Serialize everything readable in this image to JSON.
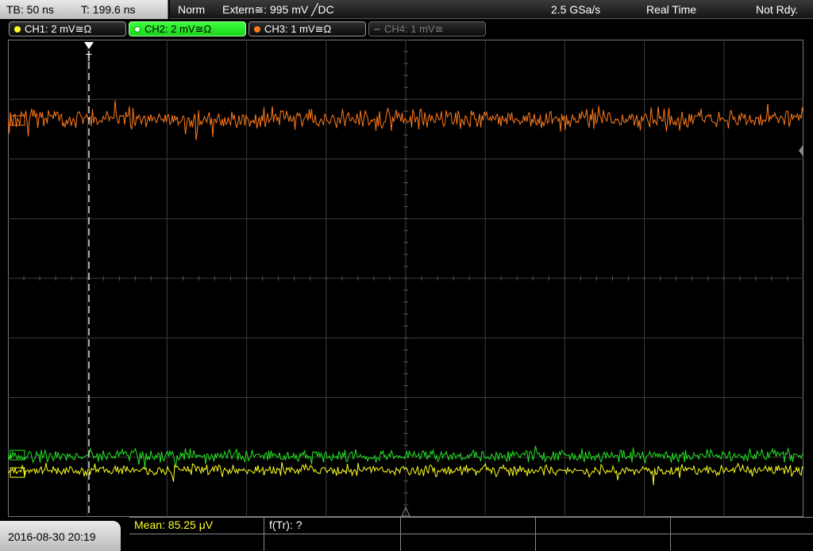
{
  "status_bar": {
    "timebase": "TB: 50 ns",
    "trigger_time": "T: 199.6 ns",
    "trigger_mode": "Norm",
    "trigger_source": "Extern≅: 995 mV ╱DC",
    "sample_rate": "2.5 GSa/s",
    "acq_mode": "Real Time",
    "acq_state": "Not Rdy."
  },
  "channels": [
    {
      "label": "CH1: 2 mV≅Ω",
      "color": "#ffff20",
      "state": "on"
    },
    {
      "label": "CH2: 2 mV≅Ω",
      "color": "#22e622",
      "state": "selected"
    },
    {
      "label": "CH3: 1 mV≅Ω",
      "color": "#ff7a1a",
      "state": "on"
    },
    {
      "label": "CH4: 1 mV≅",
      "color": "#7a7a7a",
      "state": "off"
    }
  ],
  "icons": {
    "trigger_marker": "trigger-position-arrow-icon",
    "trigger_level": "trigger-level-icon",
    "bottom_marker": "center-position-triangle-icon"
  },
  "bottom": {
    "datetime": "2016-08-30 20:19",
    "measurement_1": "Mean: 85.25 μV",
    "measurement_2": "f(Tr): ?"
  },
  "trace_colors": {
    "ch1": "#ffff20",
    "ch2": "#22e622",
    "ch3": "#ff7a1a"
  }
}
